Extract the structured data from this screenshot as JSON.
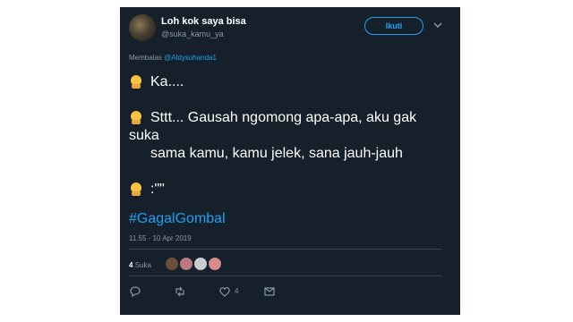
{
  "tweet": {
    "display_name": "Loh kok saya bisa",
    "handle": "@suka_kamu_ya",
    "follow_label": "Ikuti",
    "reply_prefix": "Membalas",
    "reply_to": "@Aldysuhanda1",
    "lines": [
      "Ka....",
      "Sttt... Gausah ngomong apa-apa, aku gak",
      "suka",
      "sama kamu, kamu jelek, sana jauh-jauh",
      ":\"\""
    ],
    "hashtag": "#GagalGombal",
    "timestamp": "11.55 - 10 Apr 2019",
    "like_count": "4",
    "like_label": "Suka",
    "action_like_count": "4"
  },
  "colors": {
    "background": "#15202b",
    "accent": "#1da1f2",
    "muted": "#8899a6",
    "emoji": "#f5c443"
  },
  "icons": [
    "chevron-down-icon",
    "person-emoji-icon",
    "reply-icon",
    "retweet-icon",
    "heart-icon",
    "dm-icon"
  ]
}
